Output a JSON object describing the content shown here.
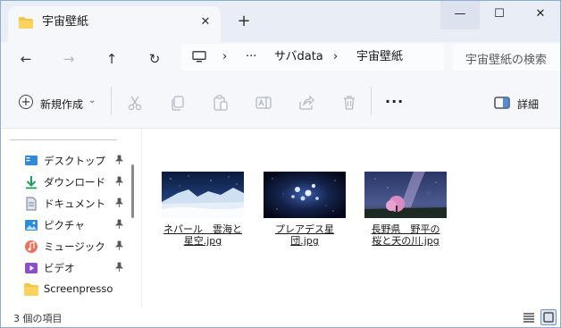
{
  "window": {
    "tab_title": "宇宙壁紙",
    "tab_close": "✕",
    "new_tab": "+",
    "minimize": "—",
    "maximize": "☐",
    "close": "✕"
  },
  "nav": {
    "back": "←",
    "forward": "→",
    "up": "↑",
    "refresh": "↻",
    "breadcrumb": {
      "sep1": "›",
      "overflow": "···",
      "folder1": "サバdata",
      "sep2": "›",
      "folder2": "宇宙壁紙"
    },
    "search_placeholder": "宇宙壁紙の検索"
  },
  "commandbar": {
    "new_label": "新規作成",
    "new_caret": "⌄",
    "more": "···",
    "details_label": "詳細"
  },
  "sidebar": {
    "items": [
      {
        "label": "デスクトップ",
        "icon": "desktop-icon",
        "pinned": true
      },
      {
        "label": "ダウンロード",
        "icon": "download-icon",
        "pinned": true
      },
      {
        "label": "ドキュメント",
        "icon": "document-icon",
        "pinned": true
      },
      {
        "label": "ピクチャ",
        "icon": "pictures-icon",
        "pinned": true
      },
      {
        "label": "ミュージック",
        "icon": "music-icon",
        "pinned": true
      },
      {
        "label": "ビデオ",
        "icon": "video-icon",
        "pinned": true
      },
      {
        "label": "Screenpresso",
        "icon": "folder-icon",
        "pinned": false
      }
    ]
  },
  "files": [
    {
      "name_line1": "ネパール　雲海と",
      "name_line2": "星空.jpg"
    },
    {
      "name_line1": "プレアデス星団.jpg",
      "name_line2": ""
    },
    {
      "name_line1": "長野県　野平の",
      "name_line2": "桜と天の川.jpg"
    }
  ],
  "status": {
    "item_count": "3 個の項目"
  },
  "colors": {
    "tabstrip": "#e8edf6",
    "toolbar": "#f5f7fb",
    "folder_yellow": "#f4c542",
    "accent_blue": "#3a78c9"
  }
}
